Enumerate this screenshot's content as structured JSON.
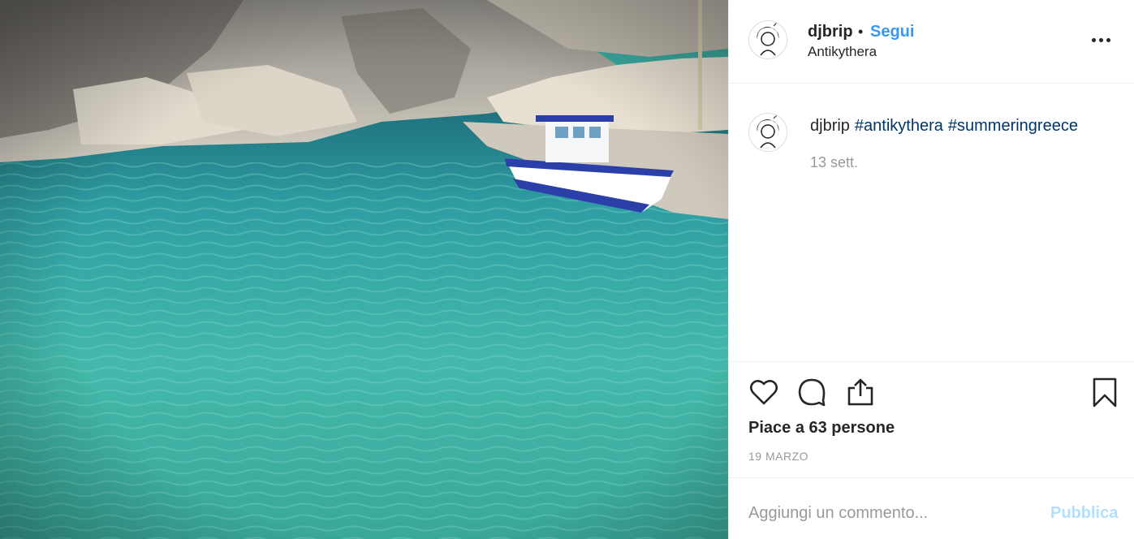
{
  "post": {
    "username": "djbrip",
    "separator": "•",
    "follow_label": "Segui",
    "location": "Antikythera",
    "more_icon": "more-options-icon",
    "caption": {
      "username": "djbrip",
      "hashtags": [
        "#antikythera",
        "#summeringreece"
      ]
    },
    "time_ago": "13 sett.",
    "likes_text": "Piace a 63 persone",
    "date": "19 MARZO",
    "comment_placeholder": "Aggiungi un commento...",
    "publish_label": "Pubblica"
  },
  "icons": {
    "like": "heart-icon",
    "comment": "comment-bubble-icon",
    "share": "share-icon",
    "save": "bookmark-icon"
  },
  "colors": {
    "link_blue": "#3897f0",
    "hashtag": "#003569",
    "muted": "#999999",
    "publish_disabled": "#b2dffc",
    "sea": "#3aa9a0"
  }
}
